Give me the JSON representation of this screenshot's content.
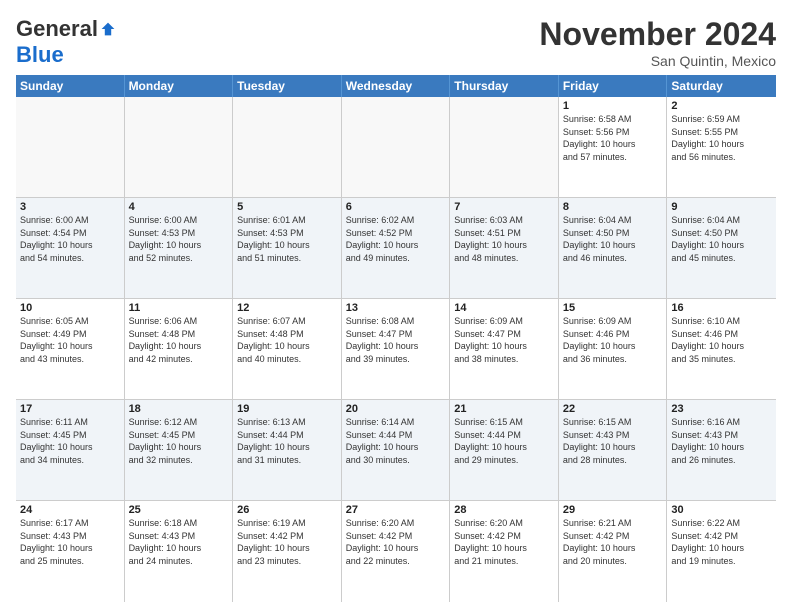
{
  "logo": {
    "general": "General",
    "blue": "Blue"
  },
  "title": "November 2024",
  "subtitle": "San Quintin, Mexico",
  "header_days": [
    "Sunday",
    "Monday",
    "Tuesday",
    "Wednesday",
    "Thursday",
    "Friday",
    "Saturday"
  ],
  "rows": [
    [
      {
        "day": "",
        "info": ""
      },
      {
        "day": "",
        "info": ""
      },
      {
        "day": "",
        "info": ""
      },
      {
        "day": "",
        "info": ""
      },
      {
        "day": "",
        "info": ""
      },
      {
        "day": "1",
        "info": "Sunrise: 6:58 AM\nSunset: 5:56 PM\nDaylight: 10 hours\nand 57 minutes."
      },
      {
        "day": "2",
        "info": "Sunrise: 6:59 AM\nSunset: 5:55 PM\nDaylight: 10 hours\nand 56 minutes."
      }
    ],
    [
      {
        "day": "3",
        "info": "Sunrise: 6:00 AM\nSunset: 4:54 PM\nDaylight: 10 hours\nand 54 minutes."
      },
      {
        "day": "4",
        "info": "Sunrise: 6:00 AM\nSunset: 4:53 PM\nDaylight: 10 hours\nand 52 minutes."
      },
      {
        "day": "5",
        "info": "Sunrise: 6:01 AM\nSunset: 4:53 PM\nDaylight: 10 hours\nand 51 minutes."
      },
      {
        "day": "6",
        "info": "Sunrise: 6:02 AM\nSunset: 4:52 PM\nDaylight: 10 hours\nand 49 minutes."
      },
      {
        "day": "7",
        "info": "Sunrise: 6:03 AM\nSunset: 4:51 PM\nDaylight: 10 hours\nand 48 minutes."
      },
      {
        "day": "8",
        "info": "Sunrise: 6:04 AM\nSunset: 4:50 PM\nDaylight: 10 hours\nand 46 minutes."
      },
      {
        "day": "9",
        "info": "Sunrise: 6:04 AM\nSunset: 4:50 PM\nDaylight: 10 hours\nand 45 minutes."
      }
    ],
    [
      {
        "day": "10",
        "info": "Sunrise: 6:05 AM\nSunset: 4:49 PM\nDaylight: 10 hours\nand 43 minutes."
      },
      {
        "day": "11",
        "info": "Sunrise: 6:06 AM\nSunset: 4:48 PM\nDaylight: 10 hours\nand 42 minutes."
      },
      {
        "day": "12",
        "info": "Sunrise: 6:07 AM\nSunset: 4:48 PM\nDaylight: 10 hours\nand 40 minutes."
      },
      {
        "day": "13",
        "info": "Sunrise: 6:08 AM\nSunset: 4:47 PM\nDaylight: 10 hours\nand 39 minutes."
      },
      {
        "day": "14",
        "info": "Sunrise: 6:09 AM\nSunset: 4:47 PM\nDaylight: 10 hours\nand 38 minutes."
      },
      {
        "day": "15",
        "info": "Sunrise: 6:09 AM\nSunset: 4:46 PM\nDaylight: 10 hours\nand 36 minutes."
      },
      {
        "day": "16",
        "info": "Sunrise: 6:10 AM\nSunset: 4:46 PM\nDaylight: 10 hours\nand 35 minutes."
      }
    ],
    [
      {
        "day": "17",
        "info": "Sunrise: 6:11 AM\nSunset: 4:45 PM\nDaylight: 10 hours\nand 34 minutes."
      },
      {
        "day": "18",
        "info": "Sunrise: 6:12 AM\nSunset: 4:45 PM\nDaylight: 10 hours\nand 32 minutes."
      },
      {
        "day": "19",
        "info": "Sunrise: 6:13 AM\nSunset: 4:44 PM\nDaylight: 10 hours\nand 31 minutes."
      },
      {
        "day": "20",
        "info": "Sunrise: 6:14 AM\nSunset: 4:44 PM\nDaylight: 10 hours\nand 30 minutes."
      },
      {
        "day": "21",
        "info": "Sunrise: 6:15 AM\nSunset: 4:44 PM\nDaylight: 10 hours\nand 29 minutes."
      },
      {
        "day": "22",
        "info": "Sunrise: 6:15 AM\nSunset: 4:43 PM\nDaylight: 10 hours\nand 28 minutes."
      },
      {
        "day": "23",
        "info": "Sunrise: 6:16 AM\nSunset: 4:43 PM\nDaylight: 10 hours\nand 26 minutes."
      }
    ],
    [
      {
        "day": "24",
        "info": "Sunrise: 6:17 AM\nSunset: 4:43 PM\nDaylight: 10 hours\nand 25 minutes."
      },
      {
        "day": "25",
        "info": "Sunrise: 6:18 AM\nSunset: 4:43 PM\nDaylight: 10 hours\nand 24 minutes."
      },
      {
        "day": "26",
        "info": "Sunrise: 6:19 AM\nSunset: 4:42 PM\nDaylight: 10 hours\nand 23 minutes."
      },
      {
        "day": "27",
        "info": "Sunrise: 6:20 AM\nSunset: 4:42 PM\nDaylight: 10 hours\nand 22 minutes."
      },
      {
        "day": "28",
        "info": "Sunrise: 6:20 AM\nSunset: 4:42 PM\nDaylight: 10 hours\nand 21 minutes."
      },
      {
        "day": "29",
        "info": "Sunrise: 6:21 AM\nSunset: 4:42 PM\nDaylight: 10 hours\nand 20 minutes."
      },
      {
        "day": "30",
        "info": "Sunrise: 6:22 AM\nSunset: 4:42 PM\nDaylight: 10 hours\nand 19 minutes."
      }
    ]
  ]
}
